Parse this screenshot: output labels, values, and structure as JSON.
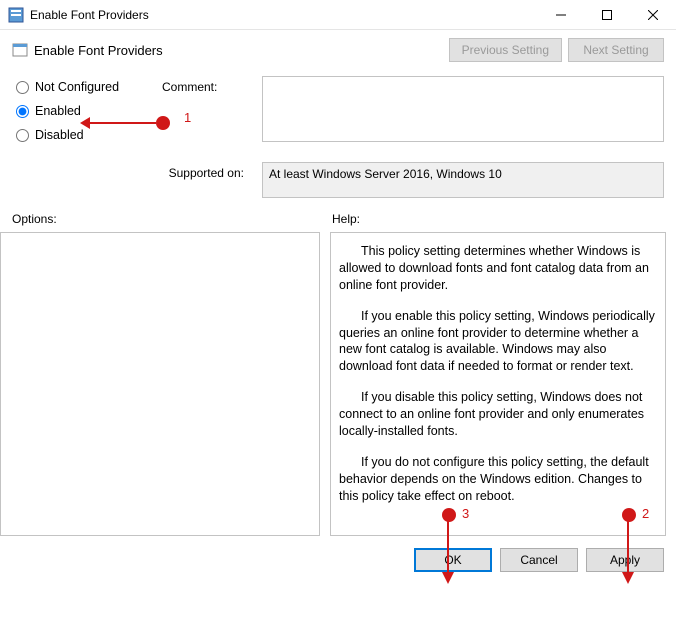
{
  "titlebar": {
    "title": "Enable Font Providers"
  },
  "subheader": {
    "title": "Enable Font Providers",
    "prev": "Previous Setting",
    "next": "Next Setting"
  },
  "radios": {
    "not_configured": "Not Configured",
    "enabled": "Enabled",
    "disabled": "Disabled",
    "selected": "enabled"
  },
  "labels": {
    "comment": "Comment:",
    "supported_on": "Supported on:",
    "options": "Options:",
    "help": "Help:"
  },
  "fields": {
    "comment_value": "",
    "supported_on_value": "At least Windows Server 2016, Windows 10"
  },
  "help": {
    "p1": "This policy setting determines whether Windows is allowed to download fonts and font catalog data from an online font provider.",
    "p2": "If you enable this policy setting, Windows periodically queries an online font provider to determine whether a new font catalog is available. Windows may also download font data if needed to format or render text.",
    "p3": "If you disable this policy setting, Windows does not connect to an online font provider and only enumerates locally-installed fonts.",
    "p4": "If you do not configure this policy setting, the default behavior depends on the Windows edition. Changes to this policy take effect on reboot."
  },
  "footer": {
    "ok": "OK",
    "cancel": "Cancel",
    "apply": "Apply"
  },
  "annotations": {
    "n1": "1",
    "n2": "2",
    "n3": "3"
  }
}
